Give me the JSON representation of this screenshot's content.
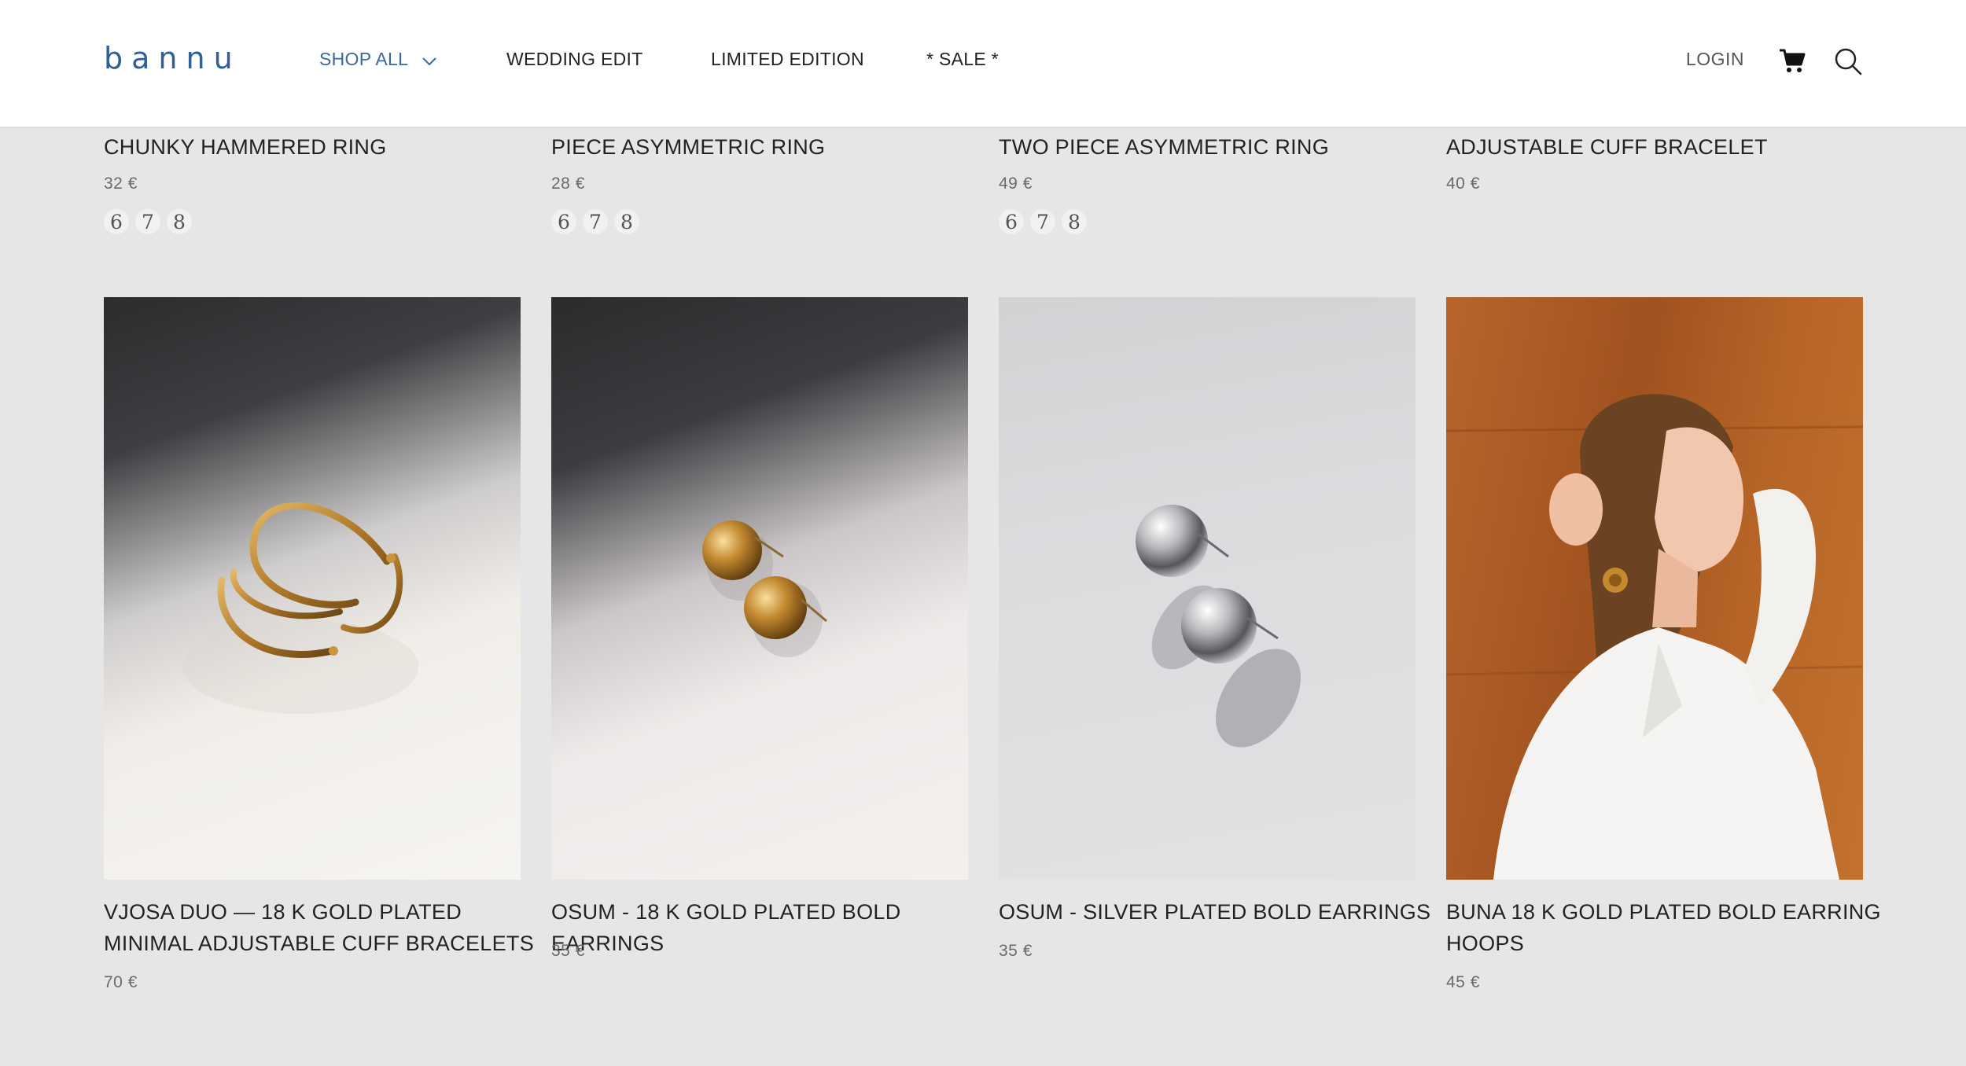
{
  "header": {
    "logo": "bannu",
    "nav": {
      "shop_all": "SHOP ALL",
      "wedding_edit": "WEDDING EDIT",
      "limited_edition": "LIMITED EDITION",
      "sale": "* SALE *"
    },
    "login": "LOGIN",
    "brand_color": "#2f5f95"
  },
  "top_row": [
    {
      "title": "CHUNKY HAMMERED RING",
      "price": "32 €",
      "sizes": [
        "6",
        "7",
        "8"
      ]
    },
    {
      "title": "PIECE ASYMMETRIC RING",
      "price": "28 €",
      "sizes": [
        "6",
        "7",
        "8"
      ]
    },
    {
      "title": "TWO PIECE ASYMMETRIC RING",
      "price": "49 €",
      "sizes": [
        "6",
        "7",
        "8"
      ]
    },
    {
      "title": "ADJUSTABLE CUFF BRACELET",
      "price": "40 €",
      "sizes": []
    }
  ],
  "products": [
    {
      "title": "VJOSA DUO — 18 K GOLD PLATED MINIMAL ADJUSTABLE CUFF BRACELETS",
      "price": "70 €",
      "image": "gold-cuff-bracelets"
    },
    {
      "title": "OSUM - 18 K GOLD PLATED BOLD EARRINGS",
      "price": "35 €",
      "image": "gold-bold-earrings"
    },
    {
      "title": "OSUM - SILVER PLATED BOLD EARRINGS",
      "price": "35 €",
      "image": "silver-bold-earrings"
    },
    {
      "title": "BUNA 18 K GOLD PLATED BOLD EARRING HOOPS",
      "price": "45 €",
      "image": "model-wearing-gold-hoops"
    }
  ]
}
